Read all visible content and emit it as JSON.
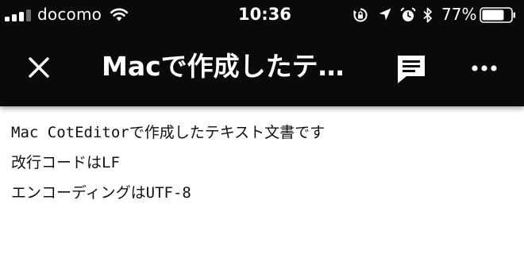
{
  "status_bar": {
    "carrier": "docomo",
    "time": "10:36",
    "battery_percent": "77%",
    "battery_level": 0.77,
    "icons": [
      "signal-icon",
      "wifi-icon",
      "orientation-lock-icon",
      "location-icon",
      "alarm-icon",
      "bluetooth-icon",
      "battery-icon"
    ]
  },
  "nav": {
    "title": "Macで作成したテ…",
    "icons": [
      "close-icon",
      "comment-icon",
      "more-icon"
    ]
  },
  "document": {
    "lines": [
      "Mac CotEditorで作成したテキスト文書です",
      "改行コードはLF",
      "エンコーディングはUTF-8"
    ]
  },
  "colors": {
    "header_background": "#0a0a0a",
    "header_text": "#ffffff",
    "body_background": "#ffffff",
    "body_text": "#111111"
  }
}
